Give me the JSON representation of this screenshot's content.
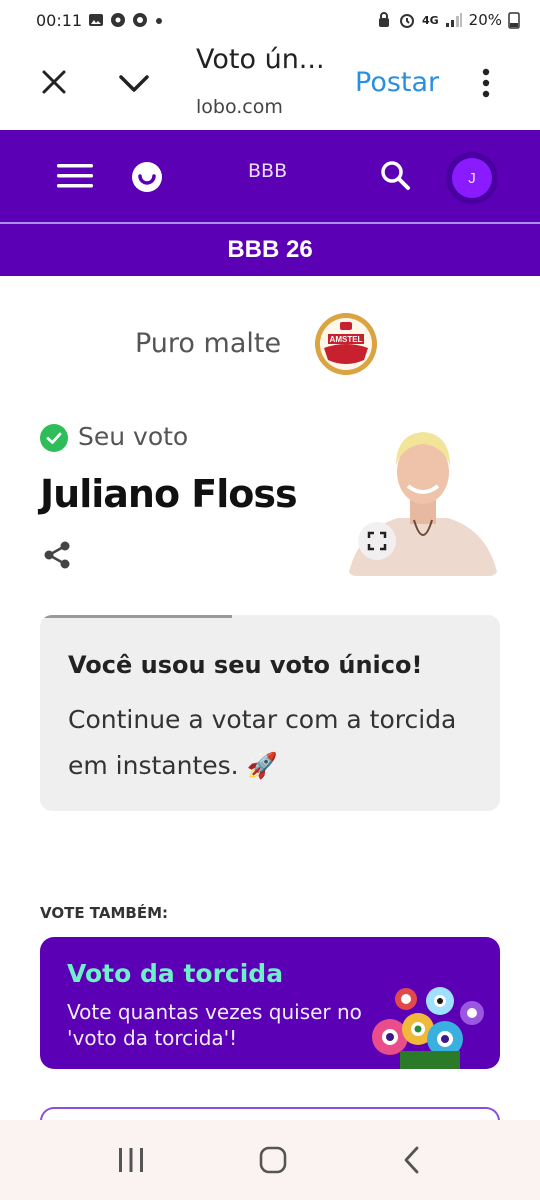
{
  "status_bar": {
    "time": "00:11",
    "signal_label": "4G",
    "battery": "20%"
  },
  "browser": {
    "title": "Voto ún...",
    "url": "lobo.com",
    "post_label": "Postar"
  },
  "site_header": {
    "section_label": "BBB",
    "avatar_initial": "J",
    "subtitle": "BBB 26"
  },
  "sponsor": {
    "text": "Puro malte",
    "brand": "AMSTEL"
  },
  "vote": {
    "status_label": "Seu voto",
    "candidate_name": "Juliano Floss"
  },
  "info_card": {
    "title": "Você usou seu voto único!",
    "message": "Continue a votar com a torcida em instantes. 🚀"
  },
  "also": {
    "heading": "VOTE TAMBÉM:",
    "promo_title": "Voto da torcida",
    "promo_text": "Vote quantas vezes quiser no 'voto da torcida'!"
  },
  "colors": {
    "brand_purple": "#5b00b4",
    "accent_green": "#6ef0c8",
    "check_green": "#2ebd59",
    "link_blue": "#2a8fe0"
  }
}
